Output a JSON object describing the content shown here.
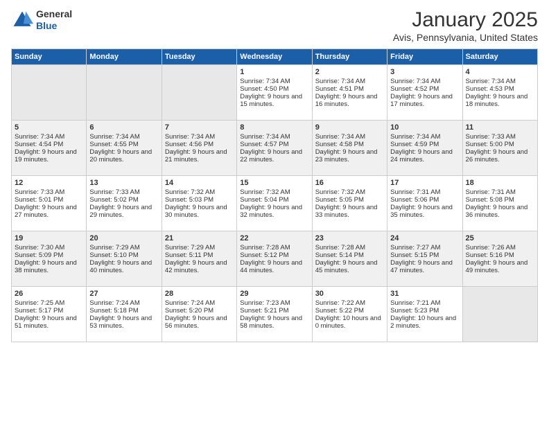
{
  "logo": {
    "line1": "General",
    "line2": "Blue"
  },
  "title": "January 2025",
  "subtitle": "Avis, Pennsylvania, United States",
  "days_header": [
    "Sunday",
    "Monday",
    "Tuesday",
    "Wednesday",
    "Thursday",
    "Friday",
    "Saturday"
  ],
  "weeks": [
    [
      {
        "day": "",
        "empty": true
      },
      {
        "day": "",
        "empty": true
      },
      {
        "day": "",
        "empty": true
      },
      {
        "day": "1",
        "sunrise": "7:34 AM",
        "sunset": "4:50 PM",
        "daylight": "9 hours and 15 minutes."
      },
      {
        "day": "2",
        "sunrise": "7:34 AM",
        "sunset": "4:51 PM",
        "daylight": "9 hours and 16 minutes."
      },
      {
        "day": "3",
        "sunrise": "7:34 AM",
        "sunset": "4:52 PM",
        "daylight": "9 hours and 17 minutes."
      },
      {
        "day": "4",
        "sunrise": "7:34 AM",
        "sunset": "4:53 PM",
        "daylight": "9 hours and 18 minutes."
      }
    ],
    [
      {
        "day": "5",
        "sunrise": "7:34 AM",
        "sunset": "4:54 PM",
        "daylight": "9 hours and 19 minutes."
      },
      {
        "day": "6",
        "sunrise": "7:34 AM",
        "sunset": "4:55 PM",
        "daylight": "9 hours and 20 minutes."
      },
      {
        "day": "7",
        "sunrise": "7:34 AM",
        "sunset": "4:56 PM",
        "daylight": "9 hours and 21 minutes."
      },
      {
        "day": "8",
        "sunrise": "7:34 AM",
        "sunset": "4:57 PM",
        "daylight": "9 hours and 22 minutes."
      },
      {
        "day": "9",
        "sunrise": "7:34 AM",
        "sunset": "4:58 PM",
        "daylight": "9 hours and 23 minutes."
      },
      {
        "day": "10",
        "sunrise": "7:34 AM",
        "sunset": "4:59 PM",
        "daylight": "9 hours and 24 minutes."
      },
      {
        "day": "11",
        "sunrise": "7:33 AM",
        "sunset": "5:00 PM",
        "daylight": "9 hours and 26 minutes."
      }
    ],
    [
      {
        "day": "12",
        "sunrise": "7:33 AM",
        "sunset": "5:01 PM",
        "daylight": "9 hours and 27 minutes."
      },
      {
        "day": "13",
        "sunrise": "7:33 AM",
        "sunset": "5:02 PM",
        "daylight": "9 hours and 29 minutes."
      },
      {
        "day": "14",
        "sunrise": "7:32 AM",
        "sunset": "5:03 PM",
        "daylight": "9 hours and 30 minutes."
      },
      {
        "day": "15",
        "sunrise": "7:32 AM",
        "sunset": "5:04 PM",
        "daylight": "9 hours and 32 minutes."
      },
      {
        "day": "16",
        "sunrise": "7:32 AM",
        "sunset": "5:05 PM",
        "daylight": "9 hours and 33 minutes."
      },
      {
        "day": "17",
        "sunrise": "7:31 AM",
        "sunset": "5:06 PM",
        "daylight": "9 hours and 35 minutes."
      },
      {
        "day": "18",
        "sunrise": "7:31 AM",
        "sunset": "5:08 PM",
        "daylight": "9 hours and 36 minutes."
      }
    ],
    [
      {
        "day": "19",
        "sunrise": "7:30 AM",
        "sunset": "5:09 PM",
        "daylight": "9 hours and 38 minutes."
      },
      {
        "day": "20",
        "sunrise": "7:29 AM",
        "sunset": "5:10 PM",
        "daylight": "9 hours and 40 minutes."
      },
      {
        "day": "21",
        "sunrise": "7:29 AM",
        "sunset": "5:11 PM",
        "daylight": "9 hours and 42 minutes."
      },
      {
        "day": "22",
        "sunrise": "7:28 AM",
        "sunset": "5:12 PM",
        "daylight": "9 hours and 44 minutes."
      },
      {
        "day": "23",
        "sunrise": "7:28 AM",
        "sunset": "5:14 PM",
        "daylight": "9 hours and 45 minutes."
      },
      {
        "day": "24",
        "sunrise": "7:27 AM",
        "sunset": "5:15 PM",
        "daylight": "9 hours and 47 minutes."
      },
      {
        "day": "25",
        "sunrise": "7:26 AM",
        "sunset": "5:16 PM",
        "daylight": "9 hours and 49 minutes."
      }
    ],
    [
      {
        "day": "26",
        "sunrise": "7:25 AM",
        "sunset": "5:17 PM",
        "daylight": "9 hours and 51 minutes."
      },
      {
        "day": "27",
        "sunrise": "7:24 AM",
        "sunset": "5:18 PM",
        "daylight": "9 hours and 53 minutes."
      },
      {
        "day": "28",
        "sunrise": "7:24 AM",
        "sunset": "5:20 PM",
        "daylight": "9 hours and 56 minutes."
      },
      {
        "day": "29",
        "sunrise": "7:23 AM",
        "sunset": "5:21 PM",
        "daylight": "9 hours and 58 minutes."
      },
      {
        "day": "30",
        "sunrise": "7:22 AM",
        "sunset": "5:22 PM",
        "daylight": "10 hours and 0 minutes."
      },
      {
        "day": "31",
        "sunrise": "7:21 AM",
        "sunset": "5:23 PM",
        "daylight": "10 hours and 2 minutes."
      },
      {
        "day": "",
        "empty": true
      }
    ]
  ]
}
